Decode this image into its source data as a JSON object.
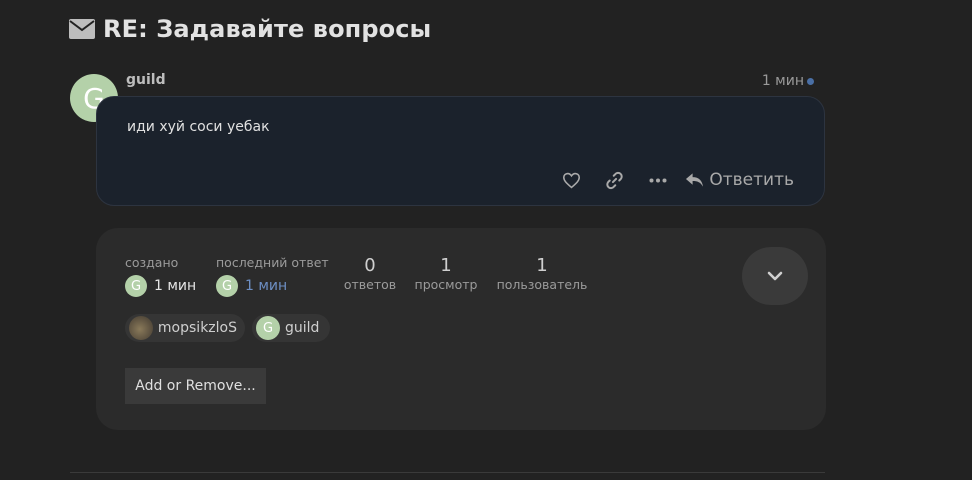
{
  "topic": {
    "title": "RE: Задавайте вопросы",
    "icon": "envelope-icon"
  },
  "post": {
    "avatar_letter": "G",
    "username": "guild",
    "time": "1 мин",
    "text": "иди хуй соси уебак",
    "reply_label": "Ответить"
  },
  "summary": {
    "created_label": "создано",
    "created_avatar": "G",
    "created_value": "1 мин",
    "last_reply_label": "последний ответ",
    "last_reply_avatar": "G",
    "last_reply_value": "1 мин",
    "replies_count": "0",
    "replies_label": "ответов",
    "views_count": "1",
    "views_label": "просмотр",
    "users_count": "1",
    "users_label": "пользователь",
    "participants": [
      {
        "name": "mopsikzloS"
      },
      {
        "name": "guild",
        "avatar_letter": "G"
      }
    ],
    "add_remove_label": "Add or Remove..."
  },
  "colors": {
    "background": "#222222",
    "post_bg": "#1b222c",
    "avatar_green": "#b4d1a9",
    "link_blue": "#6d8fc4",
    "unread_dot": "#4a6fa5"
  }
}
